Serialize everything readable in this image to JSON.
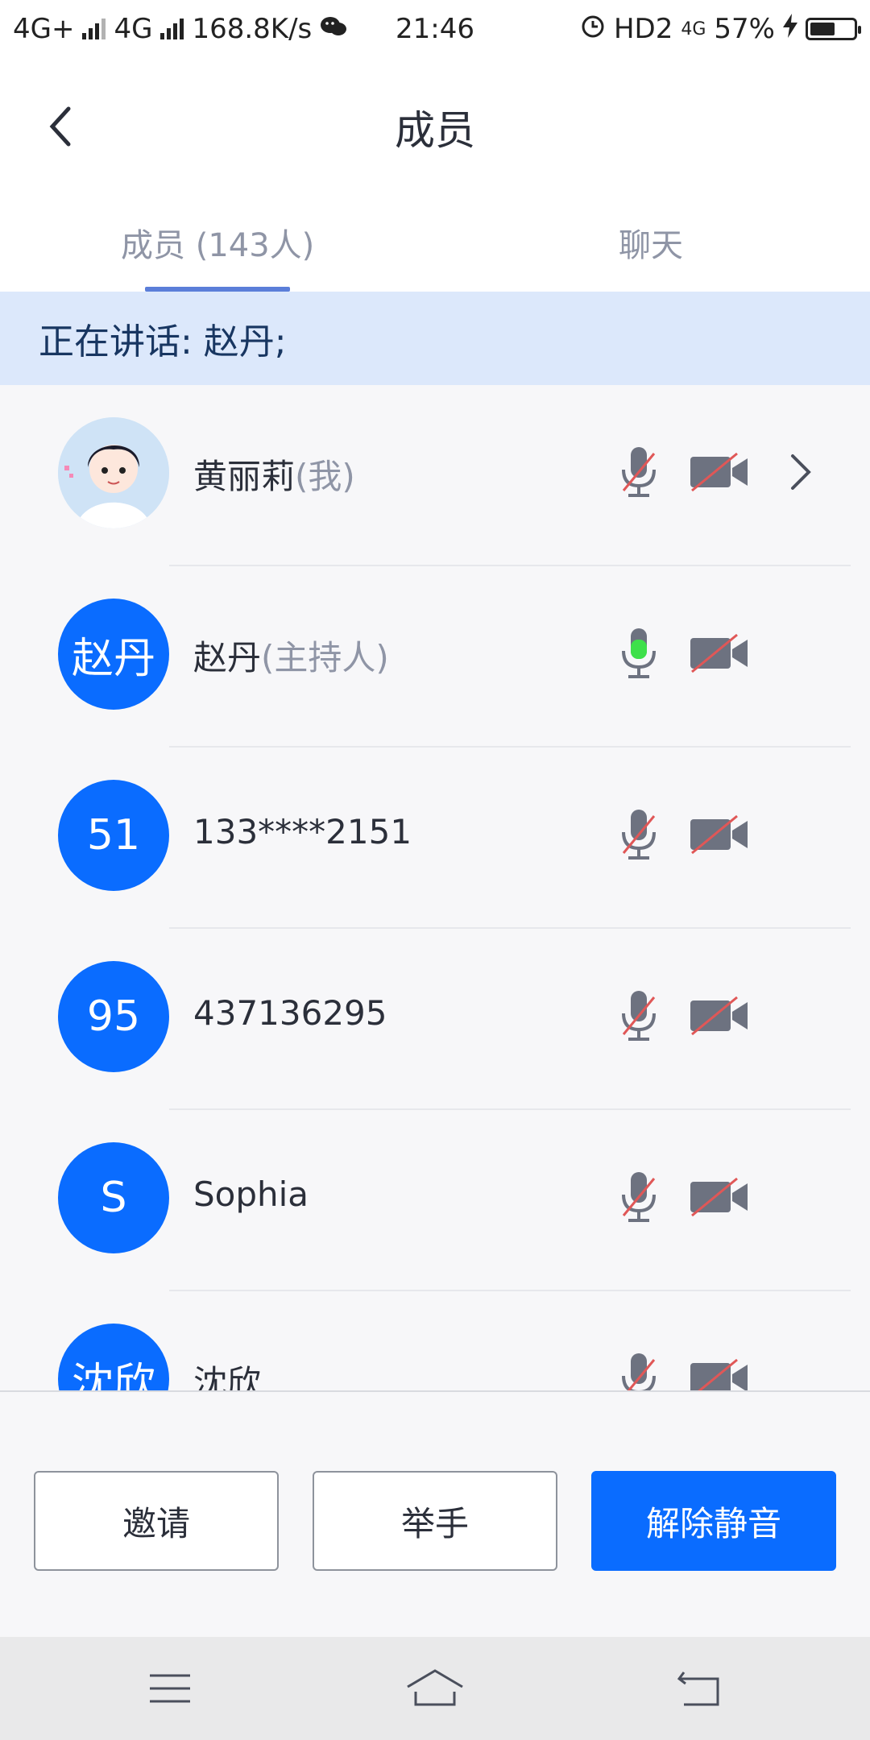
{
  "status_bar": {
    "network1": "4G+",
    "network2": "4G",
    "speed": "168.8K/s",
    "time": "21:46",
    "hd": "HD2",
    "net3": "4G",
    "battery_percent": "57%",
    "battery_level": 0.57
  },
  "header": {
    "title": "成员"
  },
  "tabs": [
    {
      "label": "成员 (143人)",
      "active": true
    },
    {
      "label": "聊天",
      "active": false
    }
  ],
  "speaking_banner": {
    "text": "正在讲话: 赵丹;"
  },
  "members": [
    {
      "avatar_text": "",
      "avatar_type": "photo",
      "name": "黄丽莉",
      "role": "(我)",
      "mic": "muted",
      "camera": "off",
      "has_chevron": true
    },
    {
      "avatar_text": "赵丹",
      "avatar_type": "text",
      "name": "赵丹",
      "role": "(主持人)",
      "mic": "active",
      "camera": "off",
      "has_chevron": false
    },
    {
      "avatar_text": "51",
      "avatar_type": "text",
      "name": "133****2151",
      "role": "",
      "mic": "muted",
      "camera": "off",
      "has_chevron": false
    },
    {
      "avatar_text": "95",
      "avatar_type": "text",
      "name": "437136295",
      "role": "",
      "mic": "muted",
      "camera": "off",
      "has_chevron": false
    },
    {
      "avatar_text": "S",
      "avatar_type": "text",
      "name": "Sophia",
      "role": "",
      "mic": "muted",
      "camera": "off",
      "has_chevron": false
    },
    {
      "avatar_text": "沈欣",
      "avatar_type": "text",
      "name": "沈欣",
      "role": "",
      "mic": "muted",
      "camera": "off",
      "has_chevron": false
    }
  ],
  "actions": {
    "invite": "邀请",
    "raise_hand": "举手",
    "unmute": "解除静音"
  },
  "colors": {
    "accent": "#0a6cff",
    "banner_bg": "#dce8fb",
    "mic_active": "#3ee04a",
    "slash_red": "#e05757"
  },
  "icons": {
    "back": "chevron-left-icon",
    "mic": "microphone-icon",
    "camera": "video-camera-icon",
    "row_chevron": "chevron-right-icon",
    "menu": "menu-icon",
    "home": "home-icon",
    "back_nav": "back-icon"
  }
}
